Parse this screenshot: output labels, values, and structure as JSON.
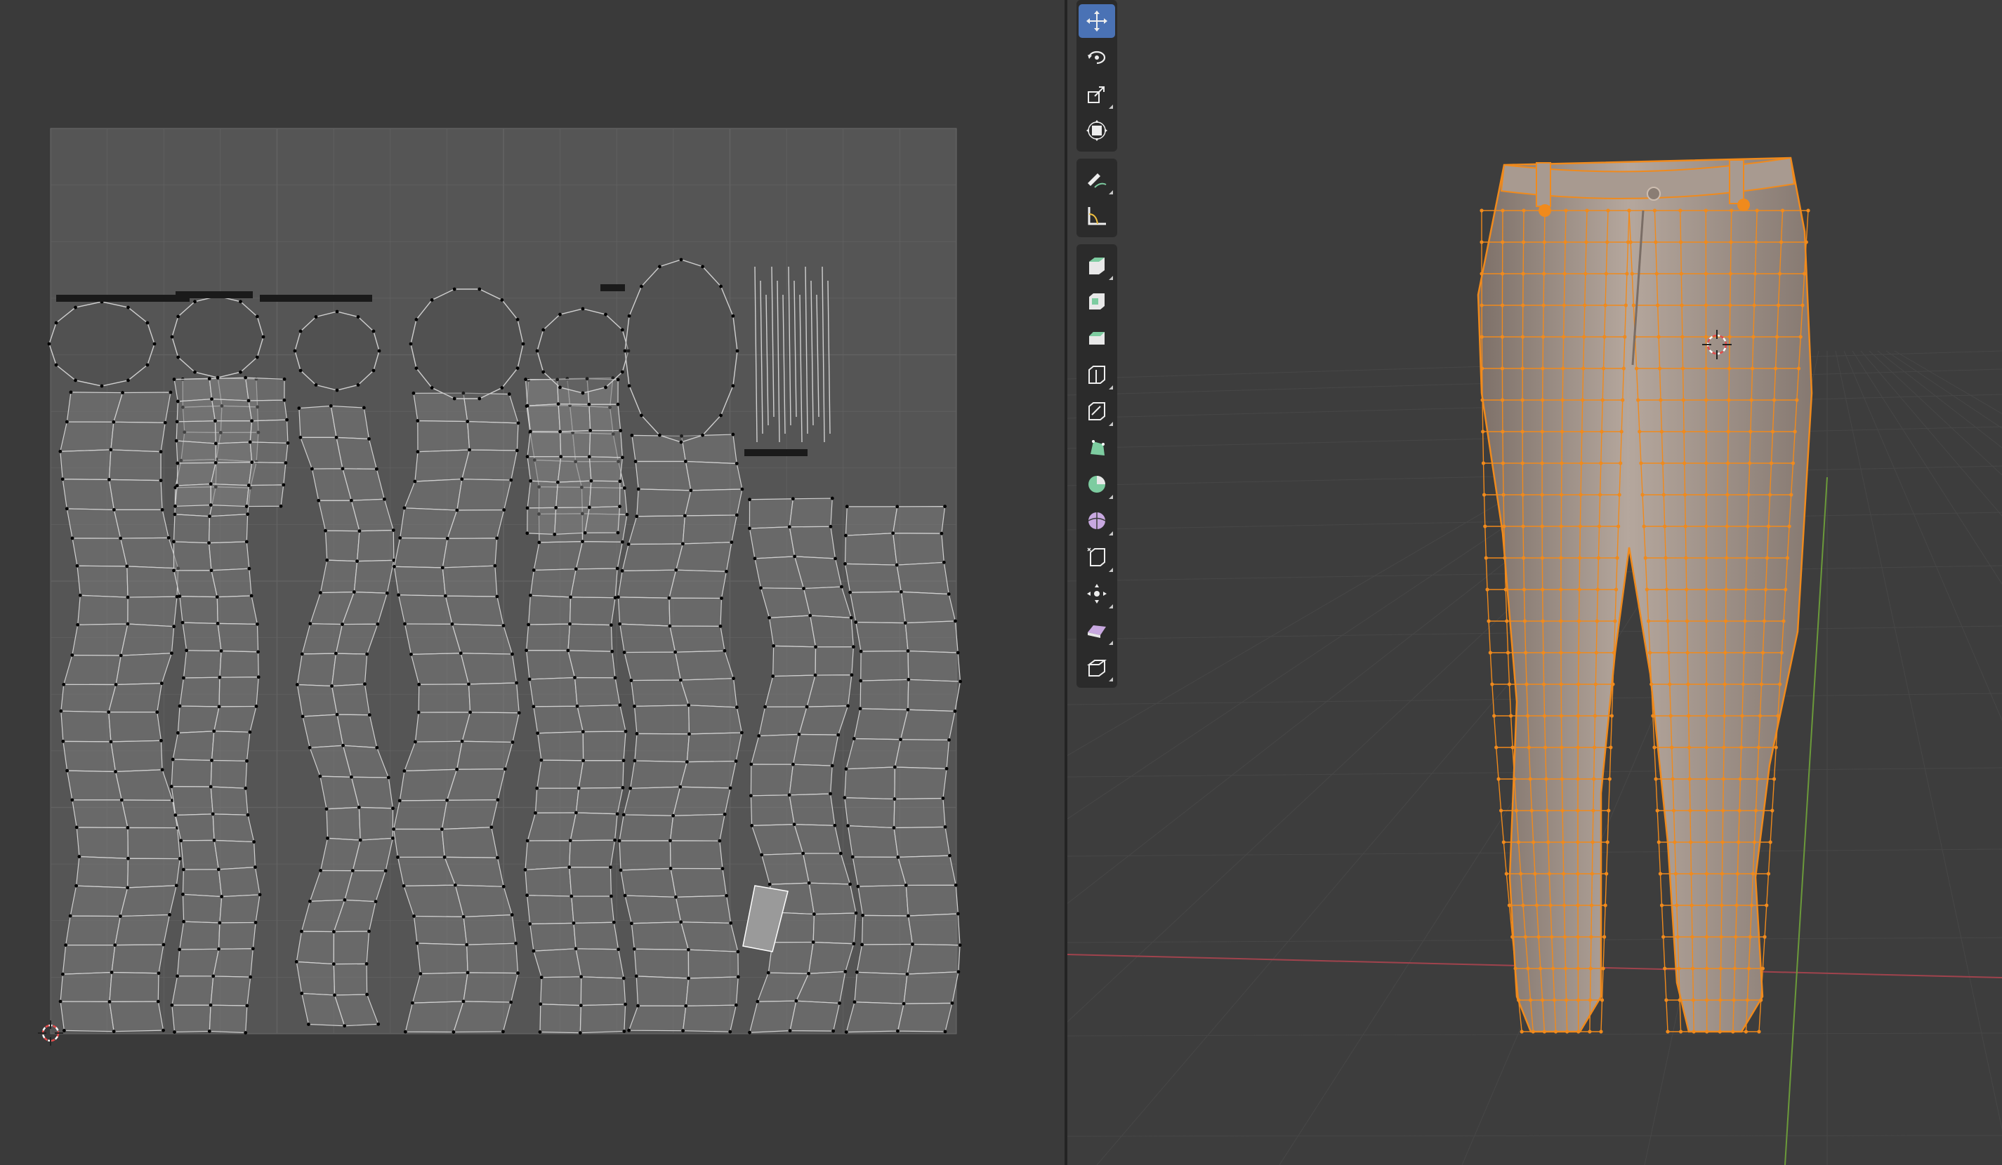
{
  "uv_editor": {
    "background": "#3a3a3a",
    "uv_grid_fill": "#555555",
    "edge_color": "#d0d0d0",
    "vertex_color": "#000000",
    "selected_face_color": "#9a9a9a"
  },
  "viewport": {
    "background": "#3d3d3d",
    "mesh_name": "pants",
    "mesh_fill": "#9b8d83",
    "wire_color": "#f08a1c",
    "x_axis_color": "#a0434d",
    "y_axis_color": "#6b9a3a"
  },
  "toolbar": {
    "groups": [
      {
        "tools": [
          {
            "icon": "move-icon"
          },
          {
            "icon": "rotate-icon"
          },
          {
            "icon": "scale-icon"
          },
          {
            "icon": "transform-icon"
          }
        ]
      },
      {
        "tools": [
          {
            "icon": "annotate-icon"
          },
          {
            "icon": "measure-icon"
          }
        ]
      },
      {
        "tools": [
          {
            "icon": "extrude-region-icon"
          },
          {
            "icon": "inset-faces-icon"
          },
          {
            "icon": "bevel-icon"
          },
          {
            "icon": "loop-cut-icon"
          },
          {
            "icon": "knife-icon"
          },
          {
            "icon": "poly-build-icon"
          },
          {
            "icon": "spin-icon"
          },
          {
            "icon": "smooth-icon"
          },
          {
            "icon": "edge-slide-icon"
          },
          {
            "icon": "shrink-fatten-icon"
          },
          {
            "icon": "shear-icon"
          },
          {
            "icon": "rip-region-icon"
          }
        ]
      }
    ]
  }
}
